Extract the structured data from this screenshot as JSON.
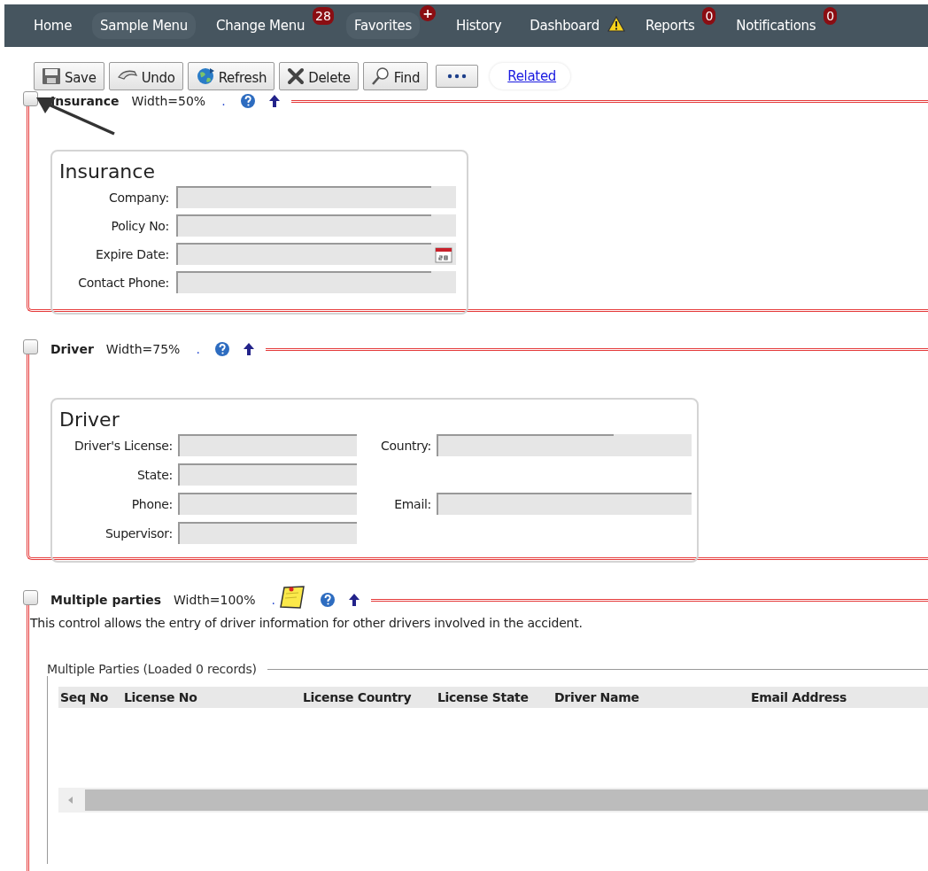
{
  "nav": {
    "items": [
      {
        "label": "Home"
      },
      {
        "label": "Sample Menu"
      },
      {
        "label": "Change Menu",
        "badge": {
          "kind": "count",
          "text": "28"
        }
      },
      {
        "label": "Favorites",
        "badge": {
          "kind": "plus",
          "text": "+"
        }
      },
      {
        "label": "History"
      },
      {
        "label": "Dashboard",
        "badge": {
          "kind": "warning"
        }
      },
      {
        "label": "Reports",
        "badge": {
          "kind": "count",
          "text": "0"
        }
      },
      {
        "label": "Notifications",
        "badge": {
          "kind": "count",
          "text": "0"
        }
      }
    ]
  },
  "toolbar": {
    "buttons": [
      {
        "kind": "save",
        "label": "Save"
      },
      {
        "kind": "undo",
        "label": "Undo"
      },
      {
        "kind": "refresh",
        "label": "Refresh"
      },
      {
        "kind": "delete",
        "label": "Delete"
      },
      {
        "kind": "find",
        "label": "Find"
      },
      {
        "kind": "more"
      }
    ],
    "link": "Related"
  },
  "sections": [
    {
      "kind": "single",
      "checked": false,
      "title": "Insurance",
      "width_label": "Width=50%",
      "dot": ".",
      "note": false,
      "pointer_arrow": true,
      "card_title": "Insurance",
      "fields": [
        {
          "label": "Company:",
          "kind": "text"
        },
        {
          "label": "Policy No:",
          "kind": "text"
        },
        {
          "label": "Expire Date:",
          "kind": "date"
        },
        {
          "label": "Contact Phone:",
          "kind": "text"
        }
      ]
    },
    {
      "kind": "double",
      "checked": false,
      "title": "Driver",
      "width_label": "Width=75%",
      "dot": ".",
      "note": false,
      "pointer_arrow": false,
      "card_title": "Driver",
      "rows": [
        {
          "left": {
            "label": "Driver's License:",
            "kind": "short"
          },
          "right": {
            "label": "Country:",
            "kind": "select"
          }
        },
        {
          "left": {
            "label": "State:",
            "kind": "short"
          }
        },
        {
          "left": {
            "label": "Phone:",
            "kind": "short"
          },
          "right": {
            "label": "Email:",
            "kind": "wide"
          }
        },
        {
          "left": {
            "label": "Supervisor:",
            "kind": "short"
          }
        }
      ]
    },
    {
      "kind": "grid",
      "checked": false,
      "title": "Multiple parties",
      "width_label": "Width=100%",
      "dot": ".",
      "note": true,
      "pointer_arrow": false,
      "description": "This control allows the entry of driver information for other drivers involved in the accident.",
      "legend": "Multiple Parties (Loaded 0 records)",
      "columns": [
        "Seq No",
        "License No",
        "License Country",
        "License State",
        "Driver Name",
        "Email Address"
      ]
    }
  ]
}
